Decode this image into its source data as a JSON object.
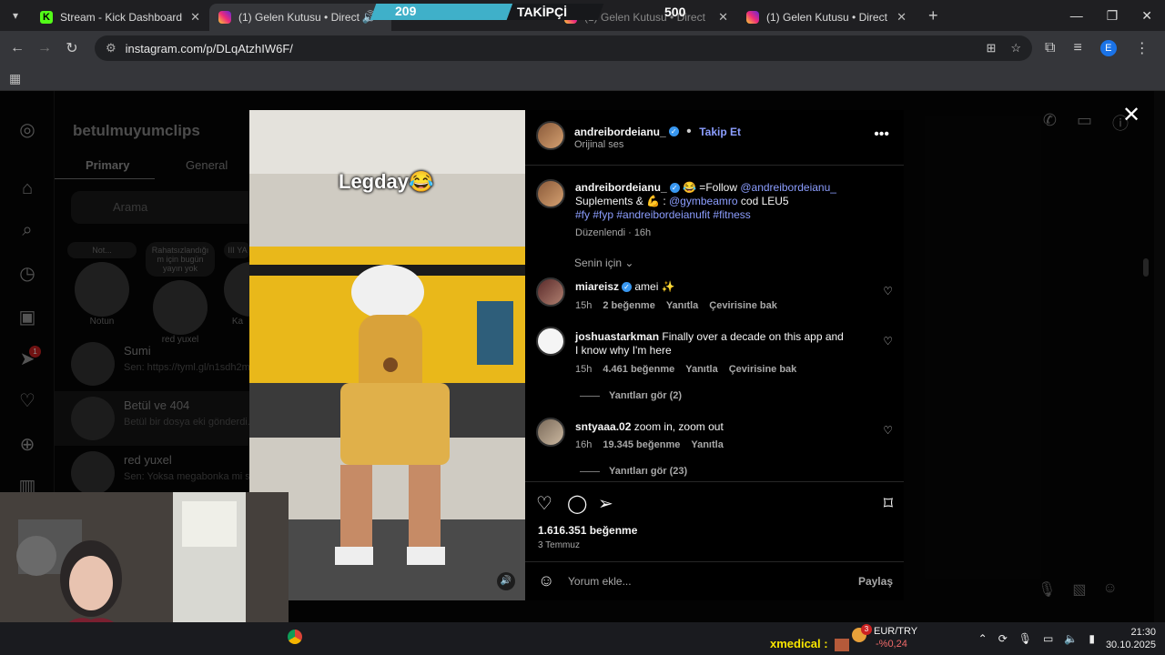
{
  "browser": {
    "tabs": [
      {
        "title": "Stream - Kick Dashboard",
        "icon": "kick-logo",
        "active": false
      },
      {
        "title": "(1) Gelen Kutusu • Direct",
        "icon": "instagram-logo",
        "active": true
      },
      {
        "title": "(1) Gelen Kutusu • Direct",
        "icon": "instagram-logo",
        "active": false
      },
      {
        "title": "(1) Gelen Kutusu • Direct",
        "icon": "instagram-logo",
        "active": false
      }
    ],
    "url": "instagram.com/p/DLqAtzhIW6F/",
    "profile_initial": "E"
  },
  "follower_goal": {
    "current": "209",
    "label": "TAKİPÇİ",
    "goal": "500"
  },
  "inbox": {
    "username": "betulmuyumclips",
    "tabs": [
      "Primary",
      "General"
    ],
    "search_placeholder": "Arama",
    "notes": [
      {
        "bubble": "Not...",
        "name": "Notun"
      },
      {
        "bubble": "Rahatsızlandığı m için bugün yayın yok",
        "name": "red yuxel"
      },
      {
        "bubble": "III YA",
        "name": "Ka"
      }
    ],
    "conversations": [
      {
        "name": "Sumi",
        "preview": "Sen: https://tyml.gl/n1sdh2m7"
      },
      {
        "name": "Betül ve 404",
        "preview": "Betül bir dosya eki gönderdi."
      },
      {
        "name": "red yuxel",
        "preview": "Sen: Yoksa megabonka mi sard"
      }
    ],
    "rail_badge": "1"
  },
  "video": {
    "caption_text": "Legday😂"
  },
  "post": {
    "author": "andreibordeianu_",
    "follow_label": "Takip Et",
    "audio_label": "Orijinal ses",
    "caption": {
      "user": "andreibordeianu_",
      "text_a": "😂 =Follow",
      "mention_a": "@andreibordeianu_",
      "text_b": "Suplements & 💪 :",
      "mention_b": "@gymbeamro",
      "text_c": "cod LEU5",
      "hashtags": "#fy #fyp #andreibordeianufit #fitness",
      "edited": "Düzenlendi · 16h"
    },
    "sort_label": "Senin için",
    "comments": [
      {
        "user": "miareisz",
        "verified": true,
        "text": "amei ✨",
        "time": "15h",
        "likes": "2 beğenme",
        "reply": "Yanıtla",
        "translate": "Çevirisine bak"
      },
      {
        "user": "joshuastarkman",
        "verified": false,
        "text": "Finally over a decade on this app and I know why I'm here",
        "time": "15h",
        "likes": "4.461 beğenme",
        "reply": "Yanıtla",
        "translate": "Çevirisine bak",
        "replies": "Yanıtları gör (2)"
      },
      {
        "user": "sntyaaa.02",
        "verified": false,
        "text": "zoom in, zoom out",
        "time": "16h",
        "likes": "19.345 beğenme",
        "reply": "Yanıtla",
        "replies": "Yanıtları gör (23)"
      }
    ],
    "likes_total": "1.616.351 beğenme",
    "date": "3 Temmuz",
    "comment_placeholder": "Yorum ekle...",
    "share_label": "Paylaş"
  },
  "taskbar": {
    "chat_user": "xmedical :",
    "ticker_label": "EUR/TRY",
    "ticker_change": "-%0,24",
    "ticker_badge": "3",
    "time": "21:30",
    "date": "30.10.2025"
  }
}
